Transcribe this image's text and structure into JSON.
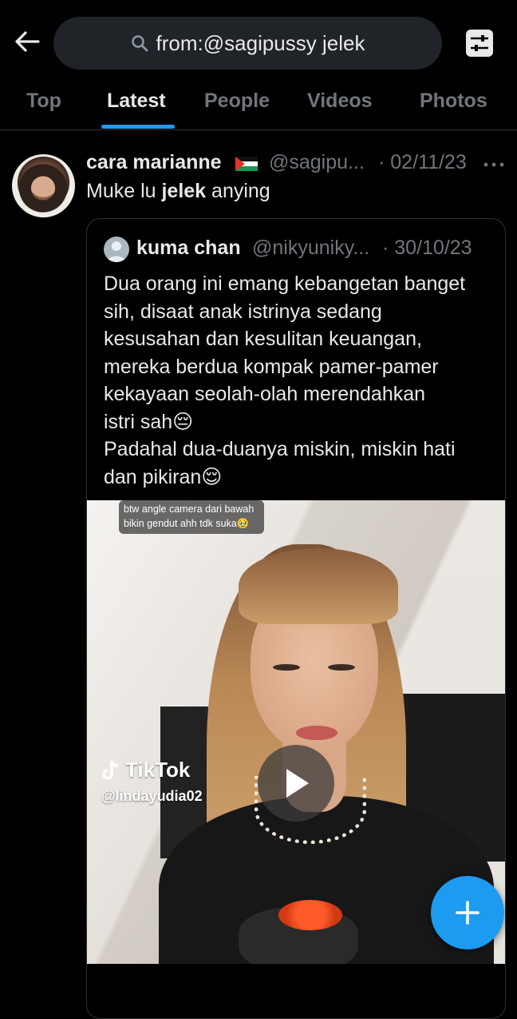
{
  "search": {
    "query": "from:@sagipussy jelek"
  },
  "tabs": [
    {
      "label": "Top",
      "active": false
    },
    {
      "label": "Latest",
      "active": true
    },
    {
      "label": "People",
      "active": false
    },
    {
      "label": "Videos",
      "active": false
    },
    {
      "label": "Photos",
      "active": false
    }
  ],
  "tweet": {
    "name": "cara marianne",
    "handle": "@sagipu...",
    "date": "· 02/11/23",
    "text_before": "Muke lu ",
    "text_bold": "jelek",
    "text_after": " anying",
    "quote": {
      "name": "kuma chan",
      "handle": "@nikyuniky...",
      "date": "· 30/10/23",
      "lines": [
        "Dua orang ini emang kebangetan banget",
        "sih, disaat anak istrinya sedang",
        "kesusahan dan kesulitan keuangan,",
        "mereka berdua kompak pamer-pamer",
        "kekayaan seolah-olah merendahkan",
        "istri sah😔",
        "Padahal dua-duanya miskin, miskin hati",
        "dan pikiran😌"
      ],
      "video": {
        "caption_line1": "btw angle camera dari bawah",
        "caption_line2": "bikin gendut ahh tdk suka🥹",
        "watermark": "TikTok",
        "watermark_user": "@lindayudia02"
      }
    }
  },
  "colors": {
    "accent": "#1d9bf0",
    "background": "#000000",
    "muted_text": "#71767b",
    "text": "#e7e9ea"
  },
  "icons": {
    "back": "arrow-left-icon",
    "search": "search-icon",
    "filter": "sliders-icon",
    "more": "more-dots-icon",
    "play": "play-icon",
    "compose": "plus-icon"
  }
}
